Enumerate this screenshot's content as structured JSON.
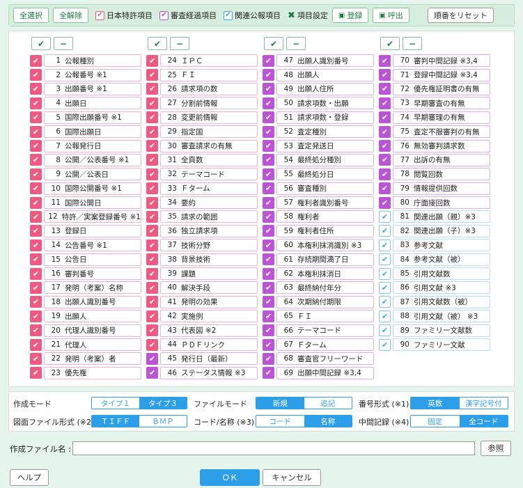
{
  "toolbar": {
    "select_all": "全選択",
    "deselect_all": "全解除",
    "legend_jp": "日本特許項目",
    "legend_exam": "審査経過項目",
    "legend_related": "関連公報項目",
    "item_settings": "項目設定",
    "register": "登録",
    "recall": "呼出",
    "reset_order": "順番をリセット"
  },
  "colors": {
    "jp": "#ee5a82",
    "exam": "#bb55d6",
    "related": "#3da7e6",
    "accent": "#2d9ee8",
    "green": "#1e7a44"
  },
  "column_controls": {
    "check": "✔",
    "uncheck": "−"
  },
  "items": [
    {
      "n": "1",
      "label": "公報種別",
      "t": "jp"
    },
    {
      "n": "2",
      "label": "公報番号 ※1",
      "t": "jp"
    },
    {
      "n": "3",
      "label": "出願番号 ※1",
      "t": "jp"
    },
    {
      "n": "4",
      "label": "出願日",
      "t": "jp"
    },
    {
      "n": "5",
      "label": "国際出願番号 ※1",
      "t": "jp"
    },
    {
      "n": "6",
      "label": "国際出願日",
      "t": "jp"
    },
    {
      "n": "7",
      "label": "公報発行日",
      "t": "jp"
    },
    {
      "n": "8",
      "label": "公開／公表番号 ※1",
      "t": "jp"
    },
    {
      "n": "9",
      "label": "公開／公表日",
      "t": "jp"
    },
    {
      "n": "10",
      "label": "国際公開番号 ※1",
      "t": "jp"
    },
    {
      "n": "11",
      "label": "国際公開日",
      "t": "jp"
    },
    {
      "n": "12",
      "label": "特許／実案登録番号 ※1",
      "t": "jp"
    },
    {
      "n": "13",
      "label": "登録日",
      "t": "jp"
    },
    {
      "n": "14",
      "label": "公告番号 ※1",
      "t": "jp"
    },
    {
      "n": "15",
      "label": "公告日",
      "t": "jp"
    },
    {
      "n": "16",
      "label": "審判番号",
      "t": "jp"
    },
    {
      "n": "17",
      "label": "発明（考案）名称",
      "t": "jp"
    },
    {
      "n": "18",
      "label": "出願人識別番号",
      "t": "jp"
    },
    {
      "n": "19",
      "label": "出願人",
      "t": "jp"
    },
    {
      "n": "20",
      "label": "代理人識別番号",
      "t": "jp"
    },
    {
      "n": "21",
      "label": "代理人",
      "t": "jp"
    },
    {
      "n": "22",
      "label": "発明（考案）者",
      "t": "jp"
    },
    {
      "n": "23",
      "label": "優先権",
      "t": "jp"
    },
    {
      "n": "24",
      "label": "ＩＰＣ",
      "t": "jp"
    },
    {
      "n": "25",
      "label": "ＦＩ",
      "t": "jp"
    },
    {
      "n": "26",
      "label": "請求項の数",
      "t": "jp"
    },
    {
      "n": "27",
      "label": "分割前情報",
      "t": "jp"
    },
    {
      "n": "28",
      "label": "変更前情報",
      "t": "jp"
    },
    {
      "n": "29",
      "label": "指定国",
      "t": "jp"
    },
    {
      "n": "30",
      "label": "審査請求の有無",
      "t": "jp"
    },
    {
      "n": "31",
      "label": "全頁数",
      "t": "jp"
    },
    {
      "n": "32",
      "label": "テーマコード",
      "t": "jp"
    },
    {
      "n": "33",
      "label": "Ｆターム",
      "t": "jp"
    },
    {
      "n": "34",
      "label": "要約",
      "t": "jp"
    },
    {
      "n": "35",
      "label": "請求の範囲",
      "t": "jp"
    },
    {
      "n": "36",
      "label": "独立請求項",
      "t": "jp"
    },
    {
      "n": "37",
      "label": "技術分野",
      "t": "jp"
    },
    {
      "n": "38",
      "label": "背景技術",
      "t": "jp"
    },
    {
      "n": "39",
      "label": "課題",
      "t": "jp"
    },
    {
      "n": "40",
      "label": "解決手段",
      "t": "jp"
    },
    {
      "n": "41",
      "label": "発明の効果",
      "t": "jp"
    },
    {
      "n": "42",
      "label": "実施例",
      "t": "jp"
    },
    {
      "n": "43",
      "label": "代表図 ※2",
      "t": "jp"
    },
    {
      "n": "44",
      "label": "ＰＤＦリンク",
      "t": "jp"
    },
    {
      "n": "45",
      "label": "発行日（最新）",
      "t": "ex"
    },
    {
      "n": "46",
      "label": "ステータス情報 ※3",
      "t": "ex"
    },
    {
      "n": "47",
      "label": "出願人識別番号",
      "t": "ex"
    },
    {
      "n": "48",
      "label": "出願人",
      "t": "ex"
    },
    {
      "n": "49",
      "label": "出願人住所",
      "t": "ex"
    },
    {
      "n": "50",
      "label": "請求項数・出願",
      "t": "ex"
    },
    {
      "n": "51",
      "label": "請求項数・登録",
      "t": "ex"
    },
    {
      "n": "52",
      "label": "査定種別",
      "t": "ex"
    },
    {
      "n": "53",
      "label": "査定発送日",
      "t": "ex"
    },
    {
      "n": "54",
      "label": "最終処分種別",
      "t": "ex"
    },
    {
      "n": "55",
      "label": "最終処分日",
      "t": "ex"
    },
    {
      "n": "56",
      "label": "審査種別",
      "t": "ex"
    },
    {
      "n": "57",
      "label": "権利者識別番号",
      "t": "ex"
    },
    {
      "n": "58",
      "label": "権利者",
      "t": "ex"
    },
    {
      "n": "59",
      "label": "権利者住所",
      "t": "ex"
    },
    {
      "n": "60",
      "label": "本権利抹消識別 ※3",
      "t": "ex"
    },
    {
      "n": "61",
      "label": "存続期間満了日",
      "t": "ex"
    },
    {
      "n": "62",
      "label": "本権利抹消日",
      "t": "ex"
    },
    {
      "n": "63",
      "label": "最終納付年分",
      "t": "ex"
    },
    {
      "n": "64",
      "label": "次期納付期限",
      "t": "ex"
    },
    {
      "n": "65",
      "label": "ＦＩ",
      "t": "ex"
    },
    {
      "n": "66",
      "label": "テーマコード",
      "t": "ex"
    },
    {
      "n": "67",
      "label": "Ｆターム",
      "t": "ex"
    },
    {
      "n": "68",
      "label": "審査官フリーワード",
      "t": "ex"
    },
    {
      "n": "69",
      "label": "出願中間記録 ※3,4",
      "t": "ex"
    },
    {
      "n": "70",
      "label": "審判中間記録 ※3,4",
      "t": "ex"
    },
    {
      "n": "71",
      "label": "登録中間記録 ※3,4",
      "t": "ex"
    },
    {
      "n": "72",
      "label": "優先権証明書の有無",
      "t": "ex"
    },
    {
      "n": "73",
      "label": "早期審査の有無",
      "t": "ex"
    },
    {
      "n": "74",
      "label": "早期審理の有無",
      "t": "ex"
    },
    {
      "n": "75",
      "label": "査定不服審判の有無",
      "t": "ex"
    },
    {
      "n": "76",
      "label": "無効審判請求数",
      "t": "ex"
    },
    {
      "n": "77",
      "label": "出訴の有無",
      "t": "ex"
    },
    {
      "n": "78",
      "label": "閲覧回数",
      "t": "ex"
    },
    {
      "n": "79",
      "label": "情報提供回数",
      "t": "ex"
    },
    {
      "n": "80",
      "label": "庁面接回数",
      "t": "ex"
    },
    {
      "n": "81",
      "label": "関連出願（親）※3",
      "t": "rel"
    },
    {
      "n": "82",
      "label": "関連出願（子）※3",
      "t": "rel"
    },
    {
      "n": "83",
      "label": "参考文献",
      "t": "rel"
    },
    {
      "n": "84",
      "label": "参考文献（被）",
      "t": "rel"
    },
    {
      "n": "85",
      "label": "引用文献数",
      "t": "rel"
    },
    {
      "n": "86",
      "label": "引用文献 ※3",
      "t": "rel"
    },
    {
      "n": "87",
      "label": "引用文献数（被）",
      "t": "rel"
    },
    {
      "n": "88",
      "label": "引用文献（被） ※3",
      "t": "rel"
    },
    {
      "n": "89",
      "label": "ファミリー文献数",
      "t": "rel"
    },
    {
      "n": "90",
      "label": "ファミリー文献",
      "t": "rel"
    }
  ],
  "options": {
    "create_mode": {
      "label": "作成モード",
      "opts": [
        "タイプ１",
        "タイプ３"
      ],
      "sel": 1
    },
    "file_mode": {
      "label": "ファイルモード",
      "opts": [
        "新規",
        "追記"
      ],
      "sel": 0
    },
    "number_format": {
      "label": "番号形式 (※1)",
      "opts": [
        "英数",
        "漢字記号付"
      ],
      "sel": 0
    },
    "image_format": {
      "label": "図面ファイル形式 (※2)",
      "opts": [
        "ＴＩＦＦ",
        "ＢＭＰ"
      ],
      "sel": 0
    },
    "code_name": {
      "label": "コード/名称 (※3)",
      "opts": [
        "コード",
        "名称"
      ],
      "sel": 1
    },
    "intermediate": {
      "label": "中間記録 (※4)",
      "opts": [
        "固定",
        "全コード"
      ],
      "sel": 1
    }
  },
  "file": {
    "label": "作成ファイル名 :",
    "value": "",
    "browse": "参照"
  },
  "footer": {
    "help": "ヘルプ",
    "ok": "ＯＫ",
    "cancel": "キャンセル"
  }
}
